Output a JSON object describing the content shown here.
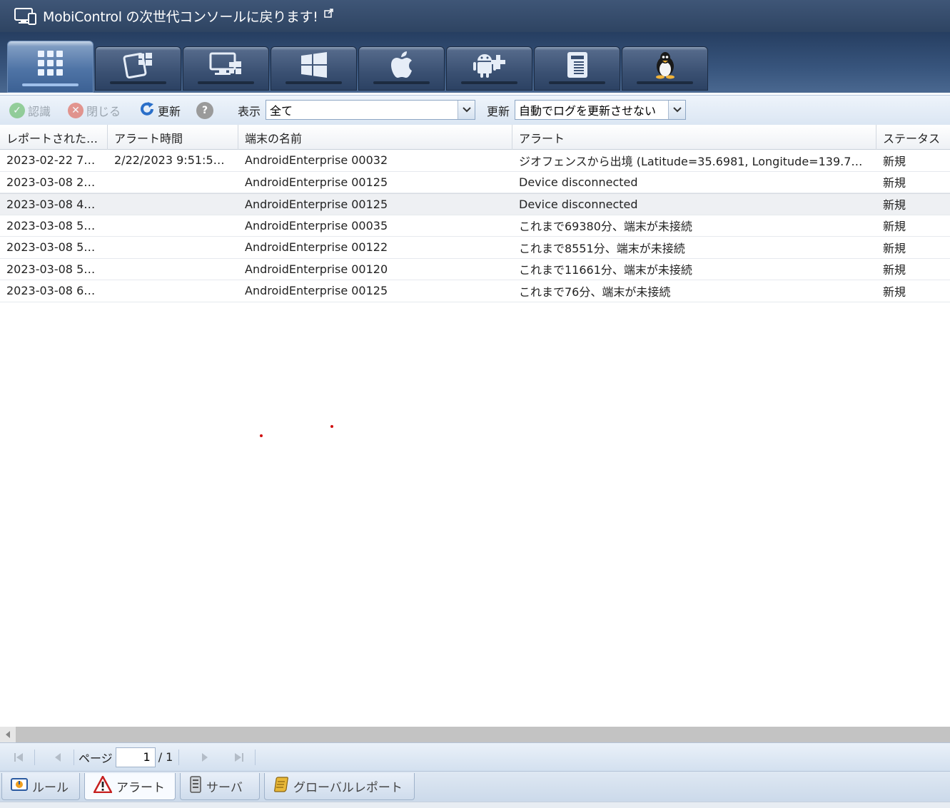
{
  "banner": {
    "title": "MobiControl の次世代コンソールに戻ります!",
    "icon": "monitor-icon",
    "link_icon": "external-link-icon"
  },
  "platform_tabs": [
    {
      "name": "all-devices",
      "icon": "grid-icon"
    },
    {
      "name": "windows-mobile",
      "icon": "windows-mobile-icon"
    },
    {
      "name": "windows-desktop",
      "icon": "windows-desktop-icon"
    },
    {
      "name": "windows-modern",
      "icon": "windows-logo-icon"
    },
    {
      "name": "apple",
      "icon": "apple-icon"
    },
    {
      "name": "android-plus",
      "icon": "android-plus-icon"
    },
    {
      "name": "printer",
      "icon": "printer-icon"
    },
    {
      "name": "linux",
      "icon": "linux-penguin-icon"
    }
  ],
  "toolbar": {
    "acknowledge": "認識",
    "close": "閉じる",
    "refresh": "更新",
    "show_label": "表示",
    "show_value": "全て",
    "update_label": "更新",
    "update_value": "自動でログを更新させない"
  },
  "grid": {
    "columns": [
      "レポートされた…",
      "アラート時間",
      "端末の名前",
      "アラート",
      "ステータス"
    ],
    "rows": [
      {
        "reported": "2023-02-22 7…",
        "alert_time": "2/22/2023 9:51:5…",
        "device": "AndroidEnterprise 00032",
        "alert": "ジオフェンスから出境 (Latitude=35.6981, Longitude=139.7…",
        "status": "新規"
      },
      {
        "reported": "2023-03-08 2…",
        "alert_time": "",
        "device": "AndroidEnterprise 00125",
        "alert": "Device disconnected",
        "status": "新規"
      },
      {
        "reported": "2023-03-08 4…",
        "alert_time": "",
        "device": "AndroidEnterprise 00125",
        "alert": "Device disconnected",
        "status": "新規"
      },
      {
        "reported": "2023-03-08 5…",
        "alert_time": "",
        "device": "AndroidEnterprise 00035",
        "alert": "これまで69380分、端末が未接続",
        "status": "新規"
      },
      {
        "reported": "2023-03-08 5…",
        "alert_time": "",
        "device": "AndroidEnterprise 00122",
        "alert": "これまで8551分、端末が未接続",
        "status": "新規"
      },
      {
        "reported": "2023-03-08 5…",
        "alert_time": "",
        "device": "AndroidEnterprise 00120",
        "alert": "これまで11661分、端末が未接続",
        "status": "新規"
      },
      {
        "reported": "2023-03-08 6…",
        "alert_time": "",
        "device": "AndroidEnterprise 00125",
        "alert": "これまで76分、端末が未接続",
        "status": "新規"
      }
    ]
  },
  "pager": {
    "page_label": "ページ",
    "current_page": "1",
    "total": "/ 1"
  },
  "bottom_tabs": [
    {
      "label": "ルール",
      "icon": "rule-icon"
    },
    {
      "label": "アラート",
      "icon": "warning-icon"
    },
    {
      "label": "サーバ",
      "icon": "server-icon"
    },
    {
      "label": "グローバルレポート",
      "icon": "report-icon"
    }
  ]
}
